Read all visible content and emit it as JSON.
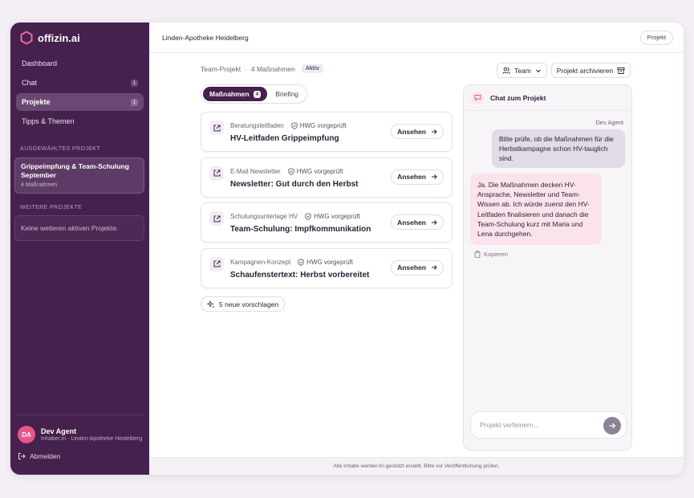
{
  "app": {
    "brand": "offizin.ai"
  },
  "sidebar": {
    "nav": [
      {
        "label": "Dashboard",
        "badge": ""
      },
      {
        "label": "Chat",
        "badge": "1"
      },
      {
        "label": "Projekte",
        "badge": "1"
      },
      {
        "label": "Tipps & Themen",
        "badge": ""
      }
    ],
    "selected_label": "AUSGEWÄHLTES PROJEKT",
    "selected_project": {
      "title": "Grippeimpfung & Team-Schulung September",
      "sub": "4 Maßnahmen"
    },
    "more_label": "WEITERE PROJEKTE",
    "more_empty": "Keine weiteren aktiven Projekte.",
    "user": {
      "initials": "DA",
      "name": "Dev Agent",
      "role": "Inhaber:in · Linden-Apotheke Heidelberg"
    },
    "logout": "Abmelden"
  },
  "topbar": {
    "title": "Linden-Apotheke Heidelberg",
    "button": "Projekt"
  },
  "header": {
    "crumb_type": "Team-Projekt",
    "crumb_count": "4 Maßnahmen",
    "status": "Aktiv",
    "team_button": "Team",
    "archive_button": "Projekt archivieren"
  },
  "tabs": [
    {
      "label": "Maßnahmen",
      "count": "4"
    },
    {
      "label": "Briefing"
    }
  ],
  "measures": [
    {
      "type": "Beratungsleitfaden",
      "check": "HWG vorgeprüft",
      "title": "HV-Leitfaden Grippeimpfung",
      "action": "Ansehen"
    },
    {
      "type": "E-Mail Newsletter",
      "check": "HWG vorgeprüft",
      "title": "Newsletter: Gut durch den Herbst",
      "action": "Ansehen"
    },
    {
      "type": "Schulungsunterlage HV",
      "check": "HWG vorgeprüft",
      "title": "Team-Schulung: Impfkommunikation",
      "action": "Ansehen"
    },
    {
      "type": "Kampagnen-Konzept",
      "check": "HWG vorgeprüft",
      "title": "Schaufenstertext: Herbst vorbereitet",
      "action": "Ansehen"
    }
  ],
  "suggest_button": "5 neue vorschlagen",
  "chat": {
    "title": "Chat zum Projekt",
    "user_author": "Dev Agent",
    "user_message": "Bitte prüfe, ob die Maßnahmen für die Herbstkampagne schon HV-tauglich sind.",
    "bot_message": "Ja. Die Maßnahmen decken HV-Ansprache, Newsletter und Team-Wissen ab. Ich würde zuerst den HV-Leitfaden finalisieren und danach die Team-Schulung kurz mit Maria und Lena durchgehen.",
    "copy_label": "Kopieren",
    "input_placeholder": "Projekt verfeinern..."
  },
  "footer": {
    "text": "Alle Inhalte werden KI-gestützt erstellt. Bitte vor Veröffentlichung prüfen."
  },
  "colors": {
    "sidebar": "#45214d",
    "accent": "#e6568a",
    "bot_bubble": "#fbe3ec",
    "user_bubble": "#e1dbe6"
  }
}
